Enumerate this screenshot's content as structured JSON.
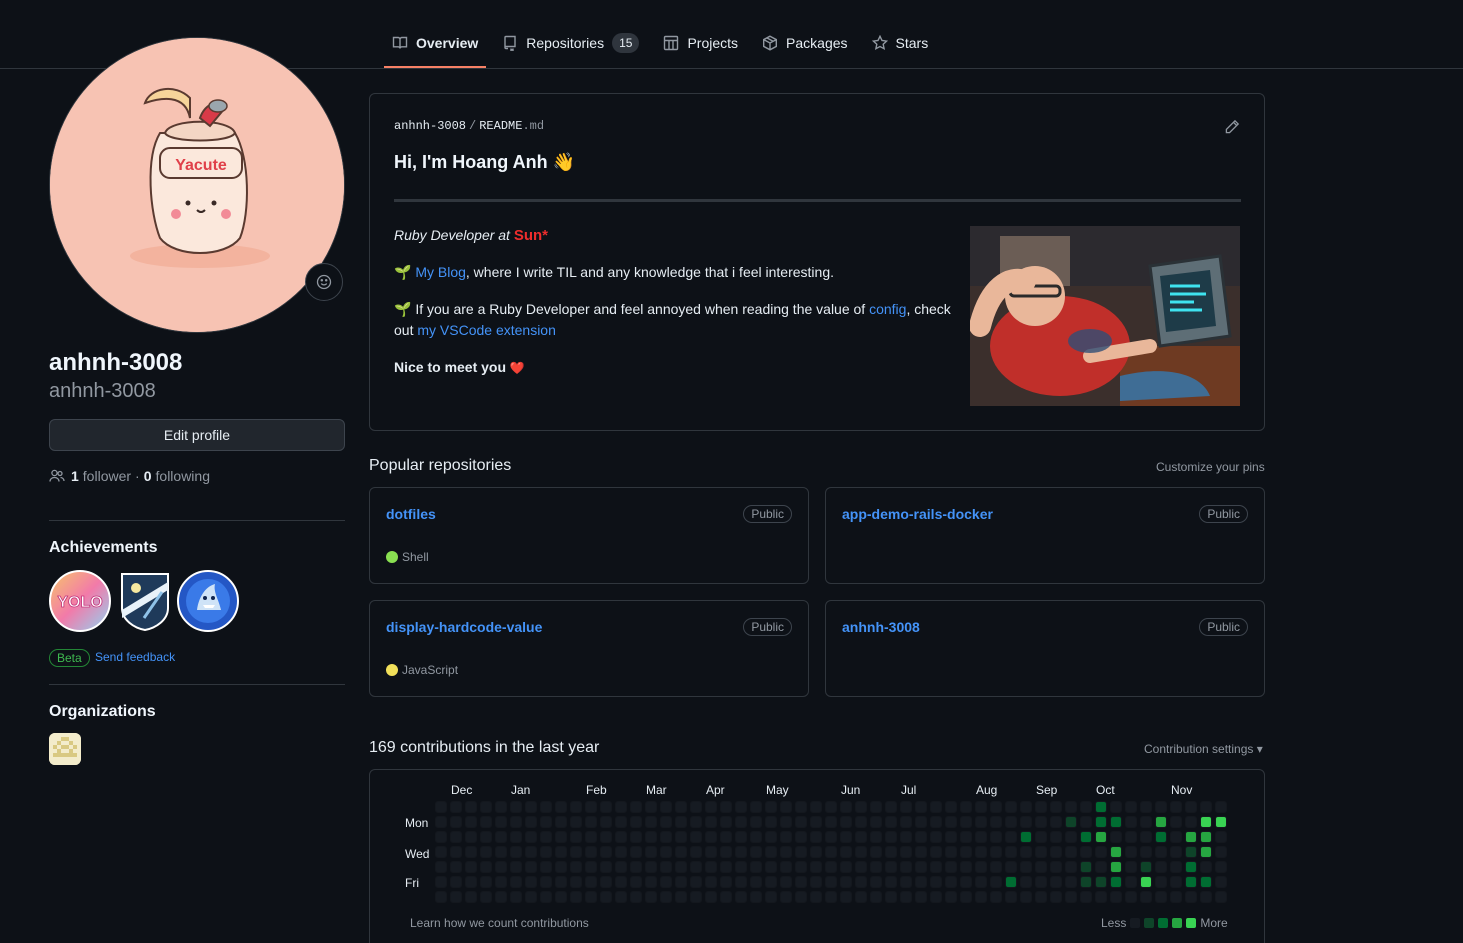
{
  "tabs": [
    {
      "label": "Overview",
      "icon": "book-icon",
      "active": true
    },
    {
      "label": "Repositories",
      "icon": "repo-icon",
      "count": "15"
    },
    {
      "label": "Projects",
      "icon": "table-icon"
    },
    {
      "label": "Packages",
      "icon": "package-icon"
    },
    {
      "label": "Stars",
      "icon": "star-icon"
    }
  ],
  "profile": {
    "name": "anhnh-3008",
    "login": "anhnh-3008",
    "avatar_text": "Yacute",
    "edit_label": "Edit profile",
    "followers": "1",
    "followers_label": "follower",
    "dot": "·",
    "following": "0",
    "following_label": "following"
  },
  "achievements": {
    "title": "Achievements",
    "badges": [
      "yolo-badge",
      "starstruck-badge",
      "pull-shark-badge"
    ],
    "yolo_text": "YOLO",
    "beta": "Beta",
    "feedback": "Send feedback"
  },
  "organizations": {
    "title": "Organizations"
  },
  "readme": {
    "owner": "anhnh-3008",
    "sep": "/",
    "file": "README",
    "ext": ".md",
    "title": "Hi, I'm Hoang Anh 👋",
    "role_prefix": "Ruby Developer at",
    "company": "Sun*",
    "blog_emoji": "🌱",
    "blog_link": "My Blog",
    "blog_text": ", where I write TIL and any knowledge that i feel interesting.",
    "ext_emoji": "🌱",
    "ext_text_1": "If you are a Ruby Developer and feel annoyed when reading the value of",
    "config_link": "config",
    "ext_text_2": ", check out",
    "vscode_link": "my VSCode extension",
    "nice": "Nice to meet you",
    "heart": "❤️"
  },
  "popular": {
    "title": "Popular repositories",
    "customize": "Customize your pins",
    "repos": [
      {
        "name": "dotfiles",
        "visibility": "Public",
        "language": "Shell",
        "color": "#89e051"
      },
      {
        "name": "app-demo-rails-docker",
        "visibility": "Public"
      },
      {
        "name": "display-hardcode-value",
        "visibility": "Public",
        "language": "JavaScript",
        "color": "#f1e05a"
      },
      {
        "name": "anhnh-3008",
        "visibility": "Public"
      }
    ]
  },
  "contributions": {
    "title": "169 contributions in the last year",
    "settings": "Contribution settings ▾",
    "months": [
      "Dec",
      "Jan",
      "Feb",
      "Mar",
      "Apr",
      "May",
      "Jun",
      "Jul",
      "Aug",
      "Sep",
      "Oct",
      "Nov"
    ],
    "days": [
      "Mon",
      "Wed",
      "Fri"
    ],
    "learn": "Learn how we count contributions",
    "less": "Less",
    "more": "More",
    "colors": [
      "#161b22",
      "#0e4429",
      "#006d32",
      "#26a641",
      "#39d353"
    ]
  }
}
